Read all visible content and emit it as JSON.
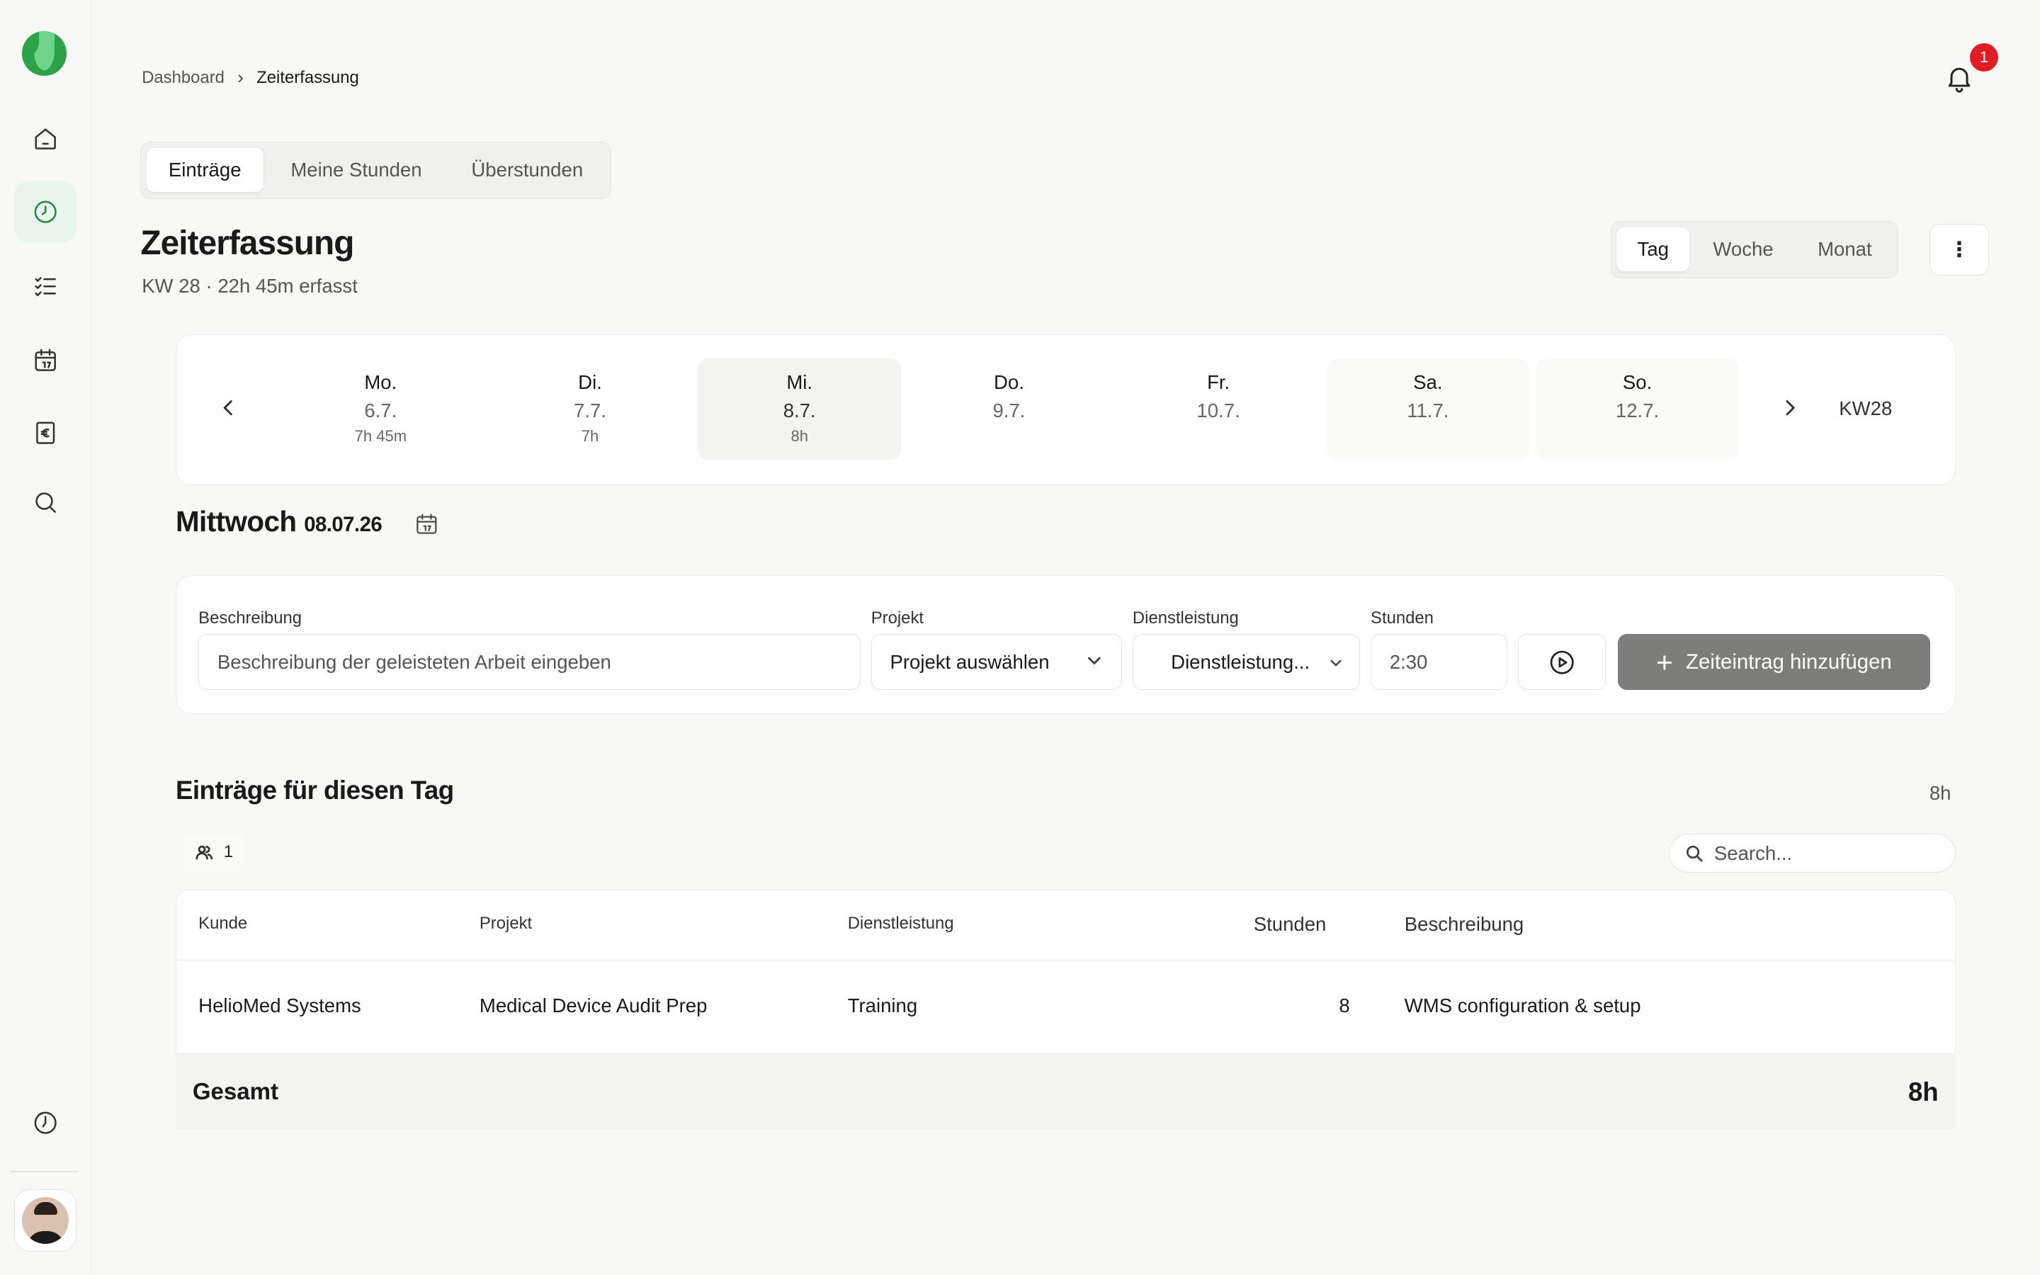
{
  "breadcrumb": {
    "root": "Dashboard",
    "current": "Zeiterfassung"
  },
  "notifications": {
    "count": "1"
  },
  "tabs": [
    {
      "label": "Einträge",
      "active": true
    },
    {
      "label": "Meine Stunden",
      "active": false
    },
    {
      "label": "Überstunden",
      "active": false
    }
  ],
  "page": {
    "title": "Zeiterfassung",
    "subtitle": "KW 28 · 22h 45m erfasst"
  },
  "view_toggle": [
    {
      "label": "Tag",
      "active": true
    },
    {
      "label": "Woche",
      "active": false
    },
    {
      "label": "Monat",
      "active": false
    }
  ],
  "week": {
    "label": "KW28",
    "days": [
      {
        "name": "Mo.",
        "date": "6.7.",
        "hours": "7h 45m"
      },
      {
        "name": "Di.",
        "date": "7.7.",
        "hours": "7h"
      },
      {
        "name": "Mi.",
        "date": "8.7.",
        "hours": "8h"
      },
      {
        "name": "Do.",
        "date": "9.7.",
        "hours": ""
      },
      {
        "name": "Fr.",
        "date": "10.7.",
        "hours": ""
      },
      {
        "name": "Sa.",
        "date": "11.7.",
        "hours": ""
      },
      {
        "name": "So.",
        "date": "12.7.",
        "hours": ""
      }
    ]
  },
  "day_heading": {
    "weekday": "Mittwoch",
    "date": "08.07.26"
  },
  "form": {
    "description_label": "Beschreibung",
    "description_placeholder": "Beschreibung der geleisteten Arbeit eingeben",
    "project_label": "Projekt",
    "project_value": "Projekt auswählen",
    "service_label": "Dienstleistung",
    "service_value": "Dienstleistung...",
    "hours_label": "Stunden",
    "hours_value": "2:30",
    "add_button": "Zeiteintrag hinzufügen"
  },
  "entries": {
    "heading": "Einträge für diesen Tag",
    "total_top": "8h",
    "people_count": "1",
    "search_placeholder": "Search...",
    "columns": [
      "Kunde",
      "Projekt",
      "Dienstleistung",
      "Stunden",
      "Beschreibung"
    ],
    "rows": [
      {
        "kunde": "HelioMed Systems",
        "projekt": "Medical Device Audit Prep",
        "dienstleistung": "Training",
        "stunden": "8",
        "beschreibung": "WMS configuration & setup"
      }
    ],
    "total_label": "Gesamt",
    "total_value": "8h"
  },
  "colors": {
    "accent": "#2aa34a",
    "active_nav_bg": "#e9f5ec",
    "badge": "#e11d23",
    "add_button_bg": "#7d7d7b"
  }
}
